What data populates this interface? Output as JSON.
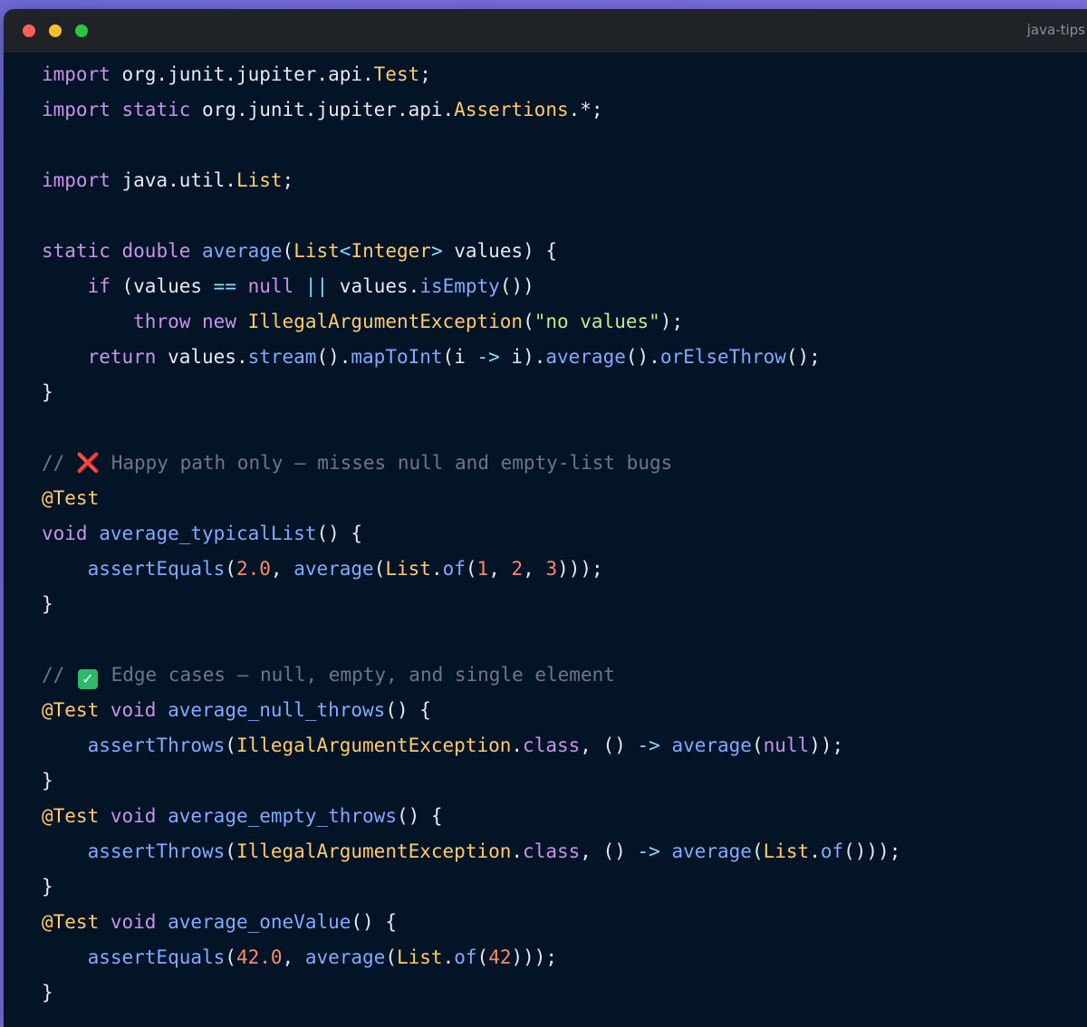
{
  "window": {
    "tab_title": "java-tips",
    "colors": {
      "background": "#041427",
      "keyword": "#c792ea",
      "type": "#ffcb6b",
      "function": "#82aaff",
      "string": "#c3e88d",
      "number": "#f78c6c",
      "comment": "#6c7686"
    }
  },
  "code": {
    "lines": [
      [
        {
          "t": "kw",
          "v": "import"
        },
        {
          "t": "pl",
          "v": " org.junit.jupiter.api."
        },
        {
          "t": "ty",
          "v": "Test"
        },
        {
          "t": "pl",
          "v": ";"
        }
      ],
      [
        {
          "t": "kw",
          "v": "import"
        },
        {
          "t": "pl",
          "v": " "
        },
        {
          "t": "kw",
          "v": "static"
        },
        {
          "t": "pl",
          "v": " org.junit.jupiter.api."
        },
        {
          "t": "ty",
          "v": "Assertions"
        },
        {
          "t": "pl",
          "v": ".*;"
        }
      ],
      [],
      [
        {
          "t": "kw",
          "v": "import"
        },
        {
          "t": "pl",
          "v": " java.util."
        },
        {
          "t": "ty",
          "v": "List"
        },
        {
          "t": "pl",
          "v": ";"
        }
      ],
      [],
      [
        {
          "t": "kw",
          "v": "static"
        },
        {
          "t": "pl",
          "v": " "
        },
        {
          "t": "kw",
          "v": "double"
        },
        {
          "t": "pl",
          "v": " "
        },
        {
          "t": "fn",
          "v": "average"
        },
        {
          "t": "pl",
          "v": "("
        },
        {
          "t": "ty",
          "v": "List"
        },
        {
          "t": "pn",
          "v": "<"
        },
        {
          "t": "ty",
          "v": "Integer"
        },
        {
          "t": "pn",
          "v": ">"
        },
        {
          "t": "pl",
          "v": " values) {"
        }
      ],
      [
        {
          "t": "pl",
          "v": "    "
        },
        {
          "t": "kw",
          "v": "if"
        },
        {
          "t": "pl",
          "v": " (values "
        },
        {
          "t": "pn",
          "v": "=="
        },
        {
          "t": "pl",
          "v": " "
        },
        {
          "t": "kw",
          "v": "null"
        },
        {
          "t": "pl",
          "v": " "
        },
        {
          "t": "pn",
          "v": "||"
        },
        {
          "t": "pl",
          "v": " values."
        },
        {
          "t": "fn",
          "v": "isEmpty"
        },
        {
          "t": "pl",
          "v": "())"
        }
      ],
      [
        {
          "t": "pl",
          "v": "        "
        },
        {
          "t": "kw",
          "v": "throw"
        },
        {
          "t": "pl",
          "v": " "
        },
        {
          "t": "kw",
          "v": "new"
        },
        {
          "t": "pl",
          "v": " "
        },
        {
          "t": "ty",
          "v": "IllegalArgumentException"
        },
        {
          "t": "pl",
          "v": "("
        },
        {
          "t": "st",
          "v": "\"no values\""
        },
        {
          "t": "pl",
          "v": ");"
        }
      ],
      [
        {
          "t": "pl",
          "v": "    "
        },
        {
          "t": "kw",
          "v": "return"
        },
        {
          "t": "pl",
          "v": " values."
        },
        {
          "t": "fn",
          "v": "stream"
        },
        {
          "t": "pl",
          "v": "()."
        },
        {
          "t": "fn",
          "v": "mapToInt"
        },
        {
          "t": "pl",
          "v": "(i "
        },
        {
          "t": "pn",
          "v": "->"
        },
        {
          "t": "pl",
          "v": " i)."
        },
        {
          "t": "fn",
          "v": "average"
        },
        {
          "t": "pl",
          "v": "()."
        },
        {
          "t": "fn",
          "v": "orElseThrow"
        },
        {
          "t": "pl",
          "v": "();"
        }
      ],
      [
        {
          "t": "pl",
          "v": "}"
        }
      ],
      [],
      [
        {
          "t": "cm",
          "v": "// "
        },
        {
          "t": "x",
          "v": "❌"
        },
        {
          "t": "cm",
          "v": " Happy path only — misses null and empty-list bugs"
        }
      ],
      [
        {
          "t": "an",
          "v": "@Test"
        }
      ],
      [
        {
          "t": "kw",
          "v": "void"
        },
        {
          "t": "pl",
          "v": " "
        },
        {
          "t": "fn",
          "v": "average_typicalList"
        },
        {
          "t": "pl",
          "v": "() {"
        }
      ],
      [
        {
          "t": "pl",
          "v": "    "
        },
        {
          "t": "fn",
          "v": "assertEquals"
        },
        {
          "t": "pl",
          "v": "("
        },
        {
          "t": "nu",
          "v": "2.0"
        },
        {
          "t": "pl",
          "v": ", "
        },
        {
          "t": "fn",
          "v": "average"
        },
        {
          "t": "pl",
          "v": "("
        },
        {
          "t": "ty",
          "v": "List"
        },
        {
          "t": "pl",
          "v": "."
        },
        {
          "t": "fn",
          "v": "of"
        },
        {
          "t": "pl",
          "v": "("
        },
        {
          "t": "nu",
          "v": "1"
        },
        {
          "t": "pl",
          "v": ", "
        },
        {
          "t": "nu",
          "v": "2"
        },
        {
          "t": "pl",
          "v": ", "
        },
        {
          "t": "nu",
          "v": "3"
        },
        {
          "t": "pl",
          "v": ")));"
        }
      ],
      [
        {
          "t": "pl",
          "v": "}"
        }
      ],
      [],
      [
        {
          "t": "cm",
          "v": "// "
        },
        {
          "t": "ck",
          "v": "✓"
        },
        {
          "t": "cm",
          "v": " Edge cases — null, empty, and single element"
        }
      ],
      [
        {
          "t": "an",
          "v": "@Test"
        },
        {
          "t": "pl",
          "v": " "
        },
        {
          "t": "kw",
          "v": "void"
        },
        {
          "t": "pl",
          "v": " "
        },
        {
          "t": "fn",
          "v": "average_null_throws"
        },
        {
          "t": "pl",
          "v": "() {"
        }
      ],
      [
        {
          "t": "pl",
          "v": "    "
        },
        {
          "t": "fn",
          "v": "assertThrows"
        },
        {
          "t": "pl",
          "v": "("
        },
        {
          "t": "ty",
          "v": "IllegalArgumentException"
        },
        {
          "t": "pl",
          "v": "."
        },
        {
          "t": "kw",
          "v": "class"
        },
        {
          "t": "pl",
          "v": ", () "
        },
        {
          "t": "pn",
          "v": "->"
        },
        {
          "t": "pl",
          "v": " "
        },
        {
          "t": "fn",
          "v": "average"
        },
        {
          "t": "pl",
          "v": "("
        },
        {
          "t": "kw",
          "v": "null"
        },
        {
          "t": "pl",
          "v": "));"
        }
      ],
      [
        {
          "t": "pl",
          "v": "}"
        }
      ],
      [
        {
          "t": "an",
          "v": "@Test"
        },
        {
          "t": "pl",
          "v": " "
        },
        {
          "t": "kw",
          "v": "void"
        },
        {
          "t": "pl",
          "v": " "
        },
        {
          "t": "fn",
          "v": "average_empty_throws"
        },
        {
          "t": "pl",
          "v": "() {"
        }
      ],
      [
        {
          "t": "pl",
          "v": "    "
        },
        {
          "t": "fn",
          "v": "assertThrows"
        },
        {
          "t": "pl",
          "v": "("
        },
        {
          "t": "ty",
          "v": "IllegalArgumentException"
        },
        {
          "t": "pl",
          "v": "."
        },
        {
          "t": "kw",
          "v": "class"
        },
        {
          "t": "pl",
          "v": ", () "
        },
        {
          "t": "pn",
          "v": "->"
        },
        {
          "t": "pl",
          "v": " "
        },
        {
          "t": "fn",
          "v": "average"
        },
        {
          "t": "pl",
          "v": "("
        },
        {
          "t": "ty",
          "v": "List"
        },
        {
          "t": "pl",
          "v": "."
        },
        {
          "t": "fn",
          "v": "of"
        },
        {
          "t": "pl",
          "v": "()));"
        }
      ],
      [
        {
          "t": "pl",
          "v": "}"
        }
      ],
      [
        {
          "t": "an",
          "v": "@Test"
        },
        {
          "t": "pl",
          "v": " "
        },
        {
          "t": "kw",
          "v": "void"
        },
        {
          "t": "pl",
          "v": " "
        },
        {
          "t": "fn",
          "v": "average_oneValue"
        },
        {
          "t": "pl",
          "v": "() {"
        }
      ],
      [
        {
          "t": "pl",
          "v": "    "
        },
        {
          "t": "fn",
          "v": "assertEquals"
        },
        {
          "t": "pl",
          "v": "("
        },
        {
          "t": "nu",
          "v": "42.0"
        },
        {
          "t": "pl",
          "v": ", "
        },
        {
          "t": "fn",
          "v": "average"
        },
        {
          "t": "pl",
          "v": "("
        },
        {
          "t": "ty",
          "v": "List"
        },
        {
          "t": "pl",
          "v": "."
        },
        {
          "t": "fn",
          "v": "of"
        },
        {
          "t": "pl",
          "v": "("
        },
        {
          "t": "nu",
          "v": "42"
        },
        {
          "t": "pl",
          "v": ")));"
        }
      ],
      [
        {
          "t": "pl",
          "v": "}"
        }
      ]
    ]
  }
}
